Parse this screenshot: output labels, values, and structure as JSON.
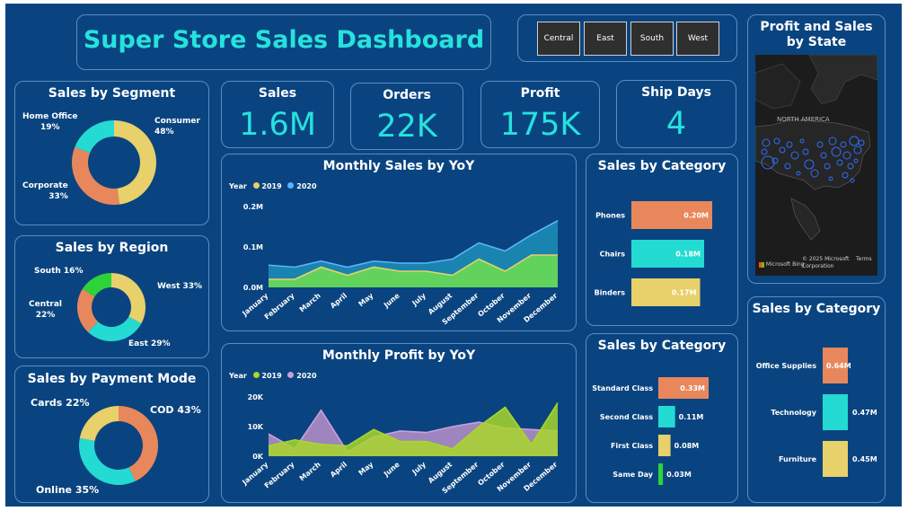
{
  "header": {
    "title": "Super Store Sales Dashboard"
  },
  "slicer": {
    "buttons": [
      "Central",
      "East",
      "South",
      "West"
    ]
  },
  "kpis": [
    {
      "label": "Sales",
      "value": "1.6M"
    },
    {
      "label": "Orders",
      "value": "22K"
    },
    {
      "label": "Profit",
      "value": "175K"
    },
    {
      "label": "Ship Days",
      "value": "4"
    }
  ],
  "segment": {
    "title": "Sales by Segment",
    "labels": {
      "home_office": [
        "Home Office",
        "19%"
      ],
      "consumer": [
        "Consumer",
        "48%"
      ],
      "corporate": [
        "Corporate",
        "33%"
      ]
    },
    "slices": [
      {
        "name": "Consumer",
        "value": 48,
        "color": "#e8d06a"
      },
      {
        "name": "Corporate",
        "value": 33,
        "color": "#e8875c"
      },
      {
        "name": "Home Office",
        "value": 19,
        "color": "#23dbd2"
      }
    ]
  },
  "region": {
    "title": "Sales by Region",
    "labels": {
      "south": "South 16%",
      "west": "West 33%",
      "central": [
        "Central",
        "22%"
      ],
      "east": "East 29%"
    },
    "slices": [
      {
        "name": "West",
        "value": 33,
        "color": "#e8d06a"
      },
      {
        "name": "East",
        "value": 29,
        "color": "#23dbd2"
      },
      {
        "name": "Central",
        "value": 22,
        "color": "#e8875c"
      },
      {
        "name": "South",
        "value": 16,
        "color": "#2ed33a"
      }
    ]
  },
  "payment": {
    "title": "Sales by Payment Mode",
    "labels": {
      "cards": "Cards 22%",
      "cod": "COD 43%",
      "online": "Online 35%"
    },
    "slices": [
      {
        "name": "COD",
        "value": 43,
        "color": "#e8875c"
      },
      {
        "name": "Online",
        "value": 35,
        "color": "#23dbd2"
      },
      {
        "name": "Cards",
        "value": 22,
        "color": "#e8d06a"
      }
    ]
  },
  "monthly_sales": {
    "title": "Monthly Sales by YoY",
    "legend": {
      "label": "Year",
      "items": [
        "2019",
        "2020"
      ]
    }
  },
  "monthly_profit": {
    "title": "Monthly Profit by YoY",
    "legend": {
      "label": "Year",
      "items": [
        "2019",
        "2020"
      ]
    }
  },
  "category1": {
    "title": "Sales by Category",
    "items": [
      {
        "name": "Phones",
        "label": "0.20M",
        "value": 0.2,
        "color": "#e8875c"
      },
      {
        "name": "Chairs",
        "label": "0.18M",
        "value": 0.18,
        "color": "#23dbd2"
      },
      {
        "name": "Binders",
        "label": "0.17M",
        "value": 0.17,
        "color": "#e8d06a"
      }
    ]
  },
  "shipmode": {
    "title": "Sales by Category",
    "items": [
      {
        "name": "Standard Class",
        "label": "0.33M",
        "value": 0.33,
        "color": "#e8875c"
      },
      {
        "name": "Second Class",
        "label": "0.11M",
        "value": 0.11,
        "color": "#23dbd2"
      },
      {
        "name": "First Class",
        "label": "0.08M",
        "value": 0.08,
        "color": "#e8d06a"
      },
      {
        "name": "Same Day",
        "label": "0.03M",
        "value": 0.03,
        "color": "#2ed33a"
      }
    ]
  },
  "category2": {
    "title": "Sales by Category",
    "items": [
      {
        "name": "Office Supplies",
        "label": "0.64M",
        "value": 0.64,
        "color": "#e8875c"
      },
      {
        "name": "Technology",
        "label": "0.47M",
        "value": 0.47,
        "color": "#23dbd2"
      },
      {
        "name": "Furniture",
        "label": "0.45M",
        "value": 0.45,
        "color": "#e8d06a"
      }
    ]
  },
  "map": {
    "title": "Profit and Sales by State",
    "continent_label": "NORTH AMERICA",
    "copyright": "© 2025 Microsoft Corporation",
    "terms": "Terms",
    "bing": "Microsoft Bing"
  },
  "chart_data": [
    {
      "type": "area",
      "title": "Monthly Sales by YoY",
      "categories": [
        "January",
        "February",
        "March",
        "April",
        "May",
        "June",
        "July",
        "August",
        "September",
        "October",
        "November",
        "December"
      ],
      "yticks": [
        "0.0M",
        "0.1M",
        "0.2M"
      ],
      "ylim": [
        0,
        0.2
      ],
      "series": [
        {
          "name": "2019",
          "color": "#e8d06a",
          "values": [
            0.02,
            0.02,
            0.05,
            0.03,
            0.05,
            0.04,
            0.04,
            0.03,
            0.07,
            0.04,
            0.08,
            0.08
          ]
        },
        {
          "name": "2020",
          "color": "#5cb3ff",
          "values": [
            0.055,
            0.05,
            0.065,
            0.05,
            0.065,
            0.06,
            0.06,
            0.07,
            0.11,
            0.09,
            0.13,
            0.165
          ]
        }
      ]
    },
    {
      "type": "area",
      "title": "Monthly Profit by YoY",
      "categories": [
        "January",
        "February",
        "March",
        "April",
        "May",
        "June",
        "July",
        "August",
        "September",
        "October",
        "November",
        "December"
      ],
      "yticks": [
        "0K",
        "10K",
        "20K"
      ],
      "ylim": [
        0,
        20000
      ],
      "series": [
        {
          "name": "2019",
          "color": "#a8d62a",
          "values": [
            3500,
            5500,
            4000,
            3500,
            9000,
            5000,
            5000,
            2500,
            10000,
            16500,
            4000,
            18000
          ]
        },
        {
          "name": "2020",
          "color": "#c9a0dc",
          "values": [
            7500,
            2500,
            15500,
            1500,
            6500,
            8500,
            8000,
            10000,
            11500,
            9500,
            9000,
            8500
          ]
        }
      ]
    }
  ]
}
